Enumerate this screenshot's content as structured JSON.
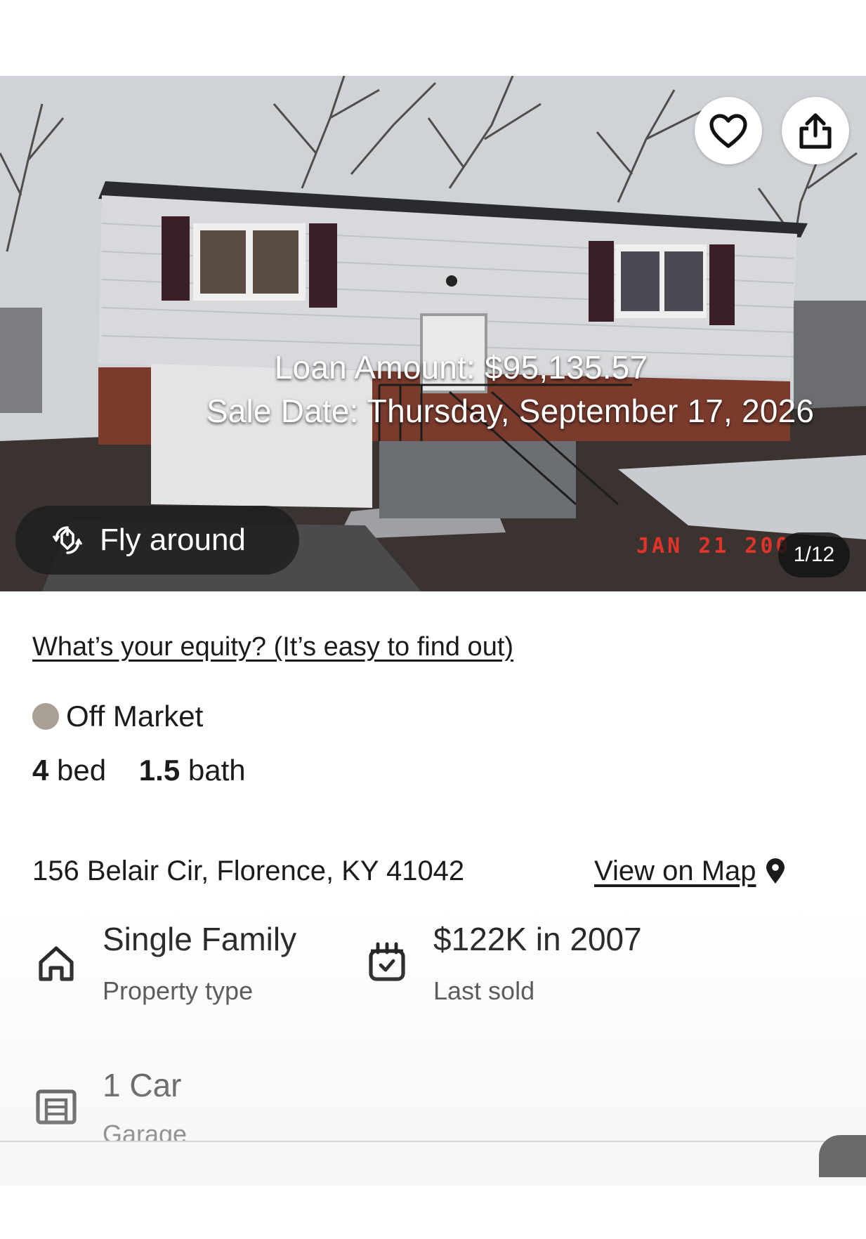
{
  "hero": {
    "loan_amount": "Loan Amount: $95,135.57",
    "sale_date": "Sale Date: Thursday, September 17, 2026",
    "fly_around_label": "Fly around",
    "photo_date_stamp": "JAN 21 200",
    "photo_counter": "1/12"
  },
  "equity_link": "What’s your equity? (It’s easy to find out)",
  "status": {
    "label": "Off Market",
    "color": "#a89f95"
  },
  "beds": {
    "count": "4",
    "label": "bed"
  },
  "baths": {
    "count": "1.5",
    "label": "bath"
  },
  "address": "156 Belair Cir, Florence, KY 41042",
  "map_link": "View on Map",
  "facts": [
    {
      "icon": "house-icon",
      "title": "Single Family",
      "subtitle": "Property type"
    },
    {
      "icon": "calendar-check-icon",
      "title": "$122K in 2007",
      "subtitle": "Last sold"
    },
    {
      "icon": "garage-icon",
      "title": "1 Car",
      "subtitle": "Garage"
    }
  ]
}
